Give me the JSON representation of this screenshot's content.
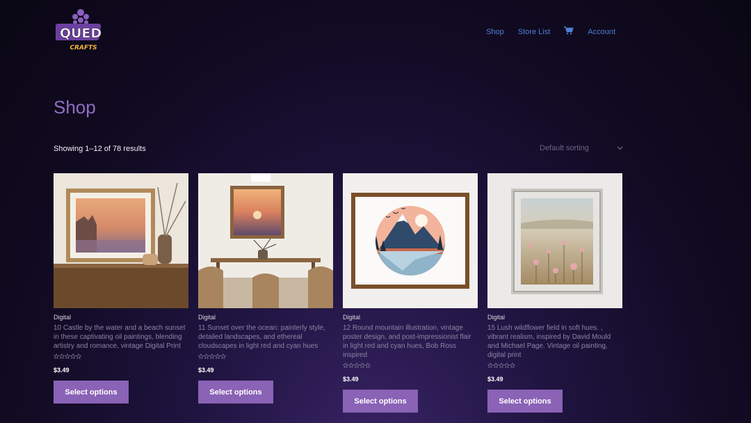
{
  "brand": {
    "line1": "QUED",
    "line2": "CRAFTS",
    "accent": "#f2b43a"
  },
  "nav": {
    "items": [
      "Shop",
      "Store List",
      "Account"
    ]
  },
  "page": {
    "title": "Shop",
    "result_count": "Showing 1–12 of 78 results",
    "sorting": "Default sorting"
  },
  "colors": {
    "button": "#8a62b6",
    "nav_link": "#4f7fd6",
    "title": "#8f6fc4"
  },
  "products": [
    {
      "category": "Digital",
      "title": "10 Castle by the water and a beach sunset in these captivating oil paintings, blending artistry and romance, vintage Digital Print",
      "rating": 0,
      "price": "$3.49",
      "button": "Select options"
    },
    {
      "category": "Digital",
      "title": "11 Sunset over the ocean: painterly style, detailed landscapes, and ethereal cloudscapes in light red and cyan hues",
      "rating": 0,
      "price": "$3.49",
      "button": "Select options"
    },
    {
      "category": "Digital",
      "title": "12 Round mountain illustration, vintage poster design, and post-impressionist flair in light red and cyan hues, Bob Ross inspired",
      "rating": 0,
      "price": "$3.49",
      "button": "Select options"
    },
    {
      "category": "Digital",
      "title": "15 Lush wildflower field in soft hues. , vibrant realism, inspired by David Mould and Michael Page. Vintage oil painting, digital print",
      "rating": 0,
      "price": "$3.49",
      "button": "Select options"
    }
  ]
}
